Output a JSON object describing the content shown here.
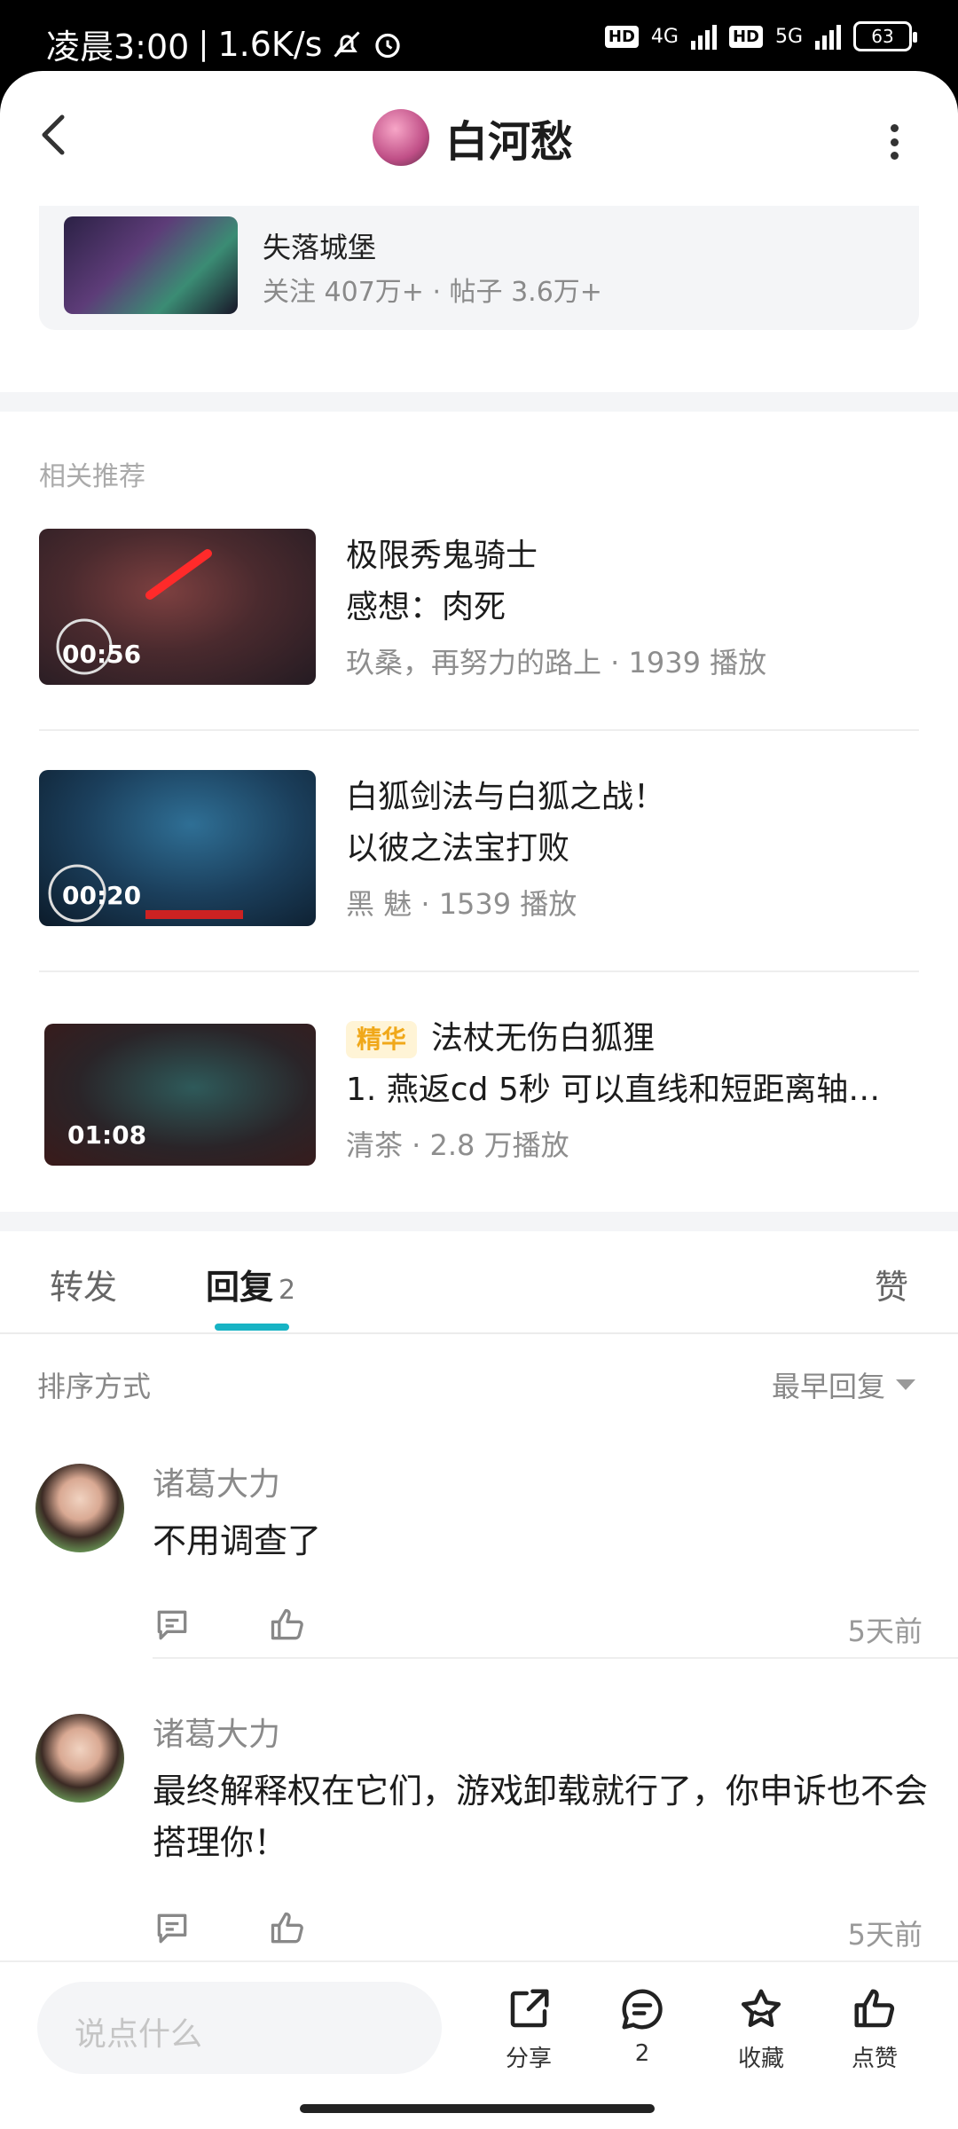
{
  "status_bar": {
    "time": "凌晨3:00",
    "speed": "1.6K/s",
    "hd1": "HD",
    "net1": "4G",
    "hd2": "HD",
    "net2": "5G",
    "battery": "63"
  },
  "header": {
    "title": "白河愁",
    "back_icon": "back-arrow-icon",
    "more_icon": "more-vertical-icon"
  },
  "forum": {
    "name": "失落城堡",
    "stats": "关注 407万+ · 帖子 3.6万+"
  },
  "recommend": {
    "label": "相关推荐",
    "items": [
      {
        "title": "极限秀鬼骑士",
        "subtitle": "感想：肉死",
        "duration": "00:56",
        "meta": "玖桑，再努力的路上 · 1939 播放"
      },
      {
        "title": "白狐剑法与白狐之战！",
        "subtitle": "以彼之法宝打败",
        "duration": "00:20",
        "meta": "黑 魅 · 1539 播放"
      },
      {
        "badge": "精华",
        "title": "法杖无伤白狐狸",
        "subtitle": "1. 燕返cd 5秒 可以直线和短距离轴…",
        "duration": "01:08",
        "meta": "清茶 · 2.8 万播放"
      }
    ]
  },
  "tabs": {
    "forward": "转发",
    "reply": "回复",
    "reply_count": "2",
    "like": "赞"
  },
  "sort": {
    "label": "排序方式",
    "value": "最早回复"
  },
  "comments": [
    {
      "user": "诸葛大力",
      "text": "不用调查了",
      "time": "5天前"
    },
    {
      "user": "诸葛大力",
      "text": "最终解释权在它们，游戏卸载就行了，你申诉也不会搭理你！",
      "time": "5天前"
    }
  ],
  "bottom_bar": {
    "input_placeholder": "说点什么",
    "share": "分享",
    "comment_count": "2",
    "favorite": "收藏",
    "like": "点赞"
  },
  "colors": {
    "accent": "#17b3c4",
    "badge_bg": "#fff4d6",
    "badge_text": "#f0a81a"
  }
}
